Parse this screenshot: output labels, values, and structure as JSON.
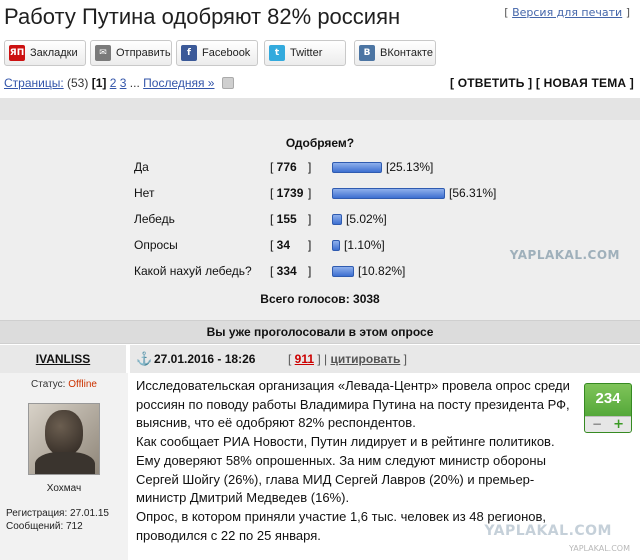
{
  "header": {
    "title": "Работу Путина одобряют 82% россиян",
    "print_prefix": "[",
    "print_link": "Версия для печати",
    "print_suffix": "]"
  },
  "share": [
    {
      "icon": "ЯП",
      "label": "Закладки",
      "color": "#cc1111"
    },
    {
      "icon": "✉",
      "label": "Отправить",
      "color": "#7a7a7a"
    },
    {
      "icon": "f",
      "label": "Facebook",
      "color": "#3b5998"
    },
    {
      "icon": "t",
      "label": "Twitter",
      "color": "#33aadd"
    },
    {
      "icon": "В",
      "label": "ВКонтакте",
      "color": "#4c75a3"
    }
  ],
  "pager": {
    "label": "Страницы:",
    "count": "(53)",
    "current": "[1]",
    "pages": [
      "2",
      "3"
    ],
    "ellipsis": "...",
    "last": "Последняя »"
  },
  "actions": {
    "reply": "[ ОТВЕТИТЬ ]",
    "new_topic": "[ НОВАЯ ТЕМА ]"
  },
  "poll": {
    "question": "Одобряем?",
    "options": [
      {
        "label": "Да",
        "votes": "776",
        "percent": "[25.13%]",
        "share": 25.13
      },
      {
        "label": "Нет",
        "votes": "1739",
        "percent": "[56.31%]",
        "share": 56.31
      },
      {
        "label": "Лебедь",
        "votes": "155",
        "percent": "[5.02%]",
        "share": 5.02
      },
      {
        "label": "Опросы",
        "votes": "34",
        "percent": "[1.10%]",
        "share": 1.1
      },
      {
        "label": "Какой нахуй лебедь?",
        "votes": "334",
        "percent": "[10.82%]",
        "share": 10.82
      }
    ],
    "total": "Всего голосов: 3038",
    "voted_notice": "Вы уже проголосовали в этом опросе"
  },
  "post": {
    "author": "IVANLISS",
    "date": "27.01.2016 - 18:26",
    "number": "911",
    "cite": "цитировать",
    "status_label": "Статус:",
    "status_value": "Offline",
    "avatar_caption": "Хохмач",
    "registration": "Регистрация: 27.01.15",
    "messages": "Сообщений: 712",
    "rating": "234",
    "paragraphs": [
      "Исследовательская организация «Левада-Центр» провела опрос среди россиян по поводу работы Владимира Путина на посту президента РФ, выяснив, что её одобряют 82% респондентов.",
      "Как сообщает РИА Новости, Путин лидирует и в рейтинге политиков. Ему доверяют 58% опрошенных. За ним следуют министр обороны Сергей Шойгу (26%), глава МИД Сергей Лавров (20%) и премьер-министр Дмитрий Медведев (16%).",
      "Опрос, в котором приняли участие 1,6 тыс. человек из 48 регионов, проводился с 22 по 25 января."
    ]
  },
  "watermarks": {
    "top": "YAPLAKAL.COM",
    "bottom": "YAPLAKAL.COM",
    "bottom_small": "YAPLAKAL.COM"
  }
}
